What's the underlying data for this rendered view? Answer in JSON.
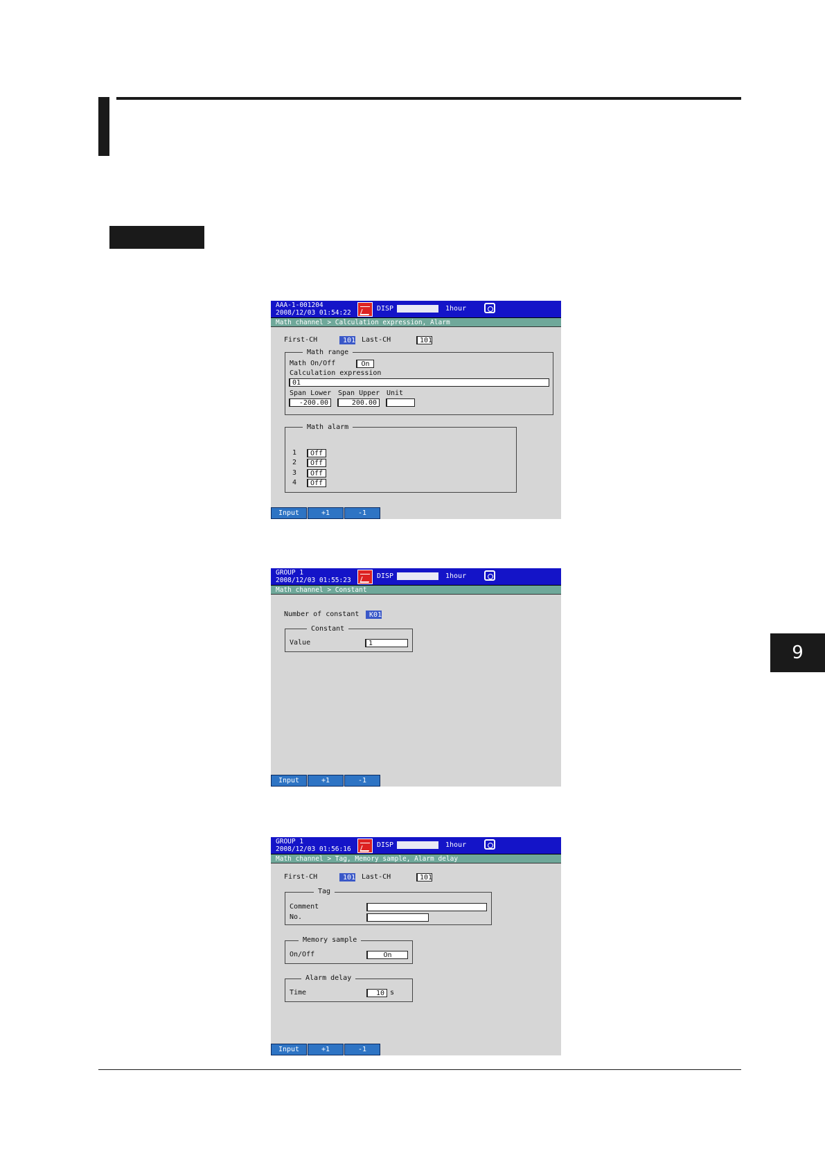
{
  "page": {
    "chapter_tab": "9"
  },
  "screens": [
    {
      "header": {
        "line1": "AAA-1-001204",
        "line2": "2008/12/03 01:54:22",
        "disp": "DISP",
        "interval": "1hour"
      },
      "path": "Math channel > Calculation expression, Alarm",
      "first_ch_label": "First-CH",
      "first_ch_value": "101",
      "last_ch_label": "Last-CH",
      "last_ch_value": "101",
      "math_range": {
        "title": "Math range",
        "onoff_label": "Math On/Off",
        "onoff_value": "On",
        "expr_label": "Calculation expression",
        "expr_value": "01",
        "span_lower_label": "Span Lower",
        "span_lower_value": "-200.00",
        "span_upper_label": "Span Upper",
        "span_upper_value": "200.00",
        "unit_label": "Unit",
        "unit_value": ""
      },
      "math_alarm": {
        "title": "Math alarm",
        "rows": [
          {
            "no": "1",
            "value": "Off"
          },
          {
            "no": "2",
            "value": "Off"
          },
          {
            "no": "3",
            "value": "Off"
          },
          {
            "no": "4",
            "value": "Off"
          }
        ]
      },
      "softkeys": [
        "Input",
        "+1",
        "-1"
      ]
    },
    {
      "header": {
        "line1": "GROUP 1",
        "line2": "2008/12/03 01:55:23",
        "disp": "DISP",
        "interval": "1hour"
      },
      "path": "Math channel > Constant",
      "number_label": "Number of constant",
      "number_value": "K01",
      "constant": {
        "title": "Constant",
        "value_label": "Value",
        "value": "1"
      },
      "softkeys": [
        "Input",
        "+1",
        "-1"
      ]
    },
    {
      "header": {
        "line1": "GROUP 1",
        "line2": "2008/12/03 01:56:16",
        "disp": "DISP",
        "interval": "1hour"
      },
      "path": "Math channel > Tag, Memory sample, Alarm delay",
      "first_ch_label": "First-CH",
      "first_ch_value": "101",
      "last_ch_label": "Last-CH",
      "last_ch_value": "101",
      "tag": {
        "title": "Tag",
        "comment_label": "Comment",
        "comment_value": "",
        "no_label": "No.",
        "no_value": ""
      },
      "memory_sample": {
        "title": "Memory sample",
        "onoff_label": "On/Off",
        "onoff_value": "On"
      },
      "alarm_delay": {
        "title": "Alarm delay",
        "time_label": "Time",
        "time_value": "10",
        "time_unit": "s"
      },
      "softkeys": [
        "Input",
        "+1",
        "-1"
      ]
    }
  ]
}
